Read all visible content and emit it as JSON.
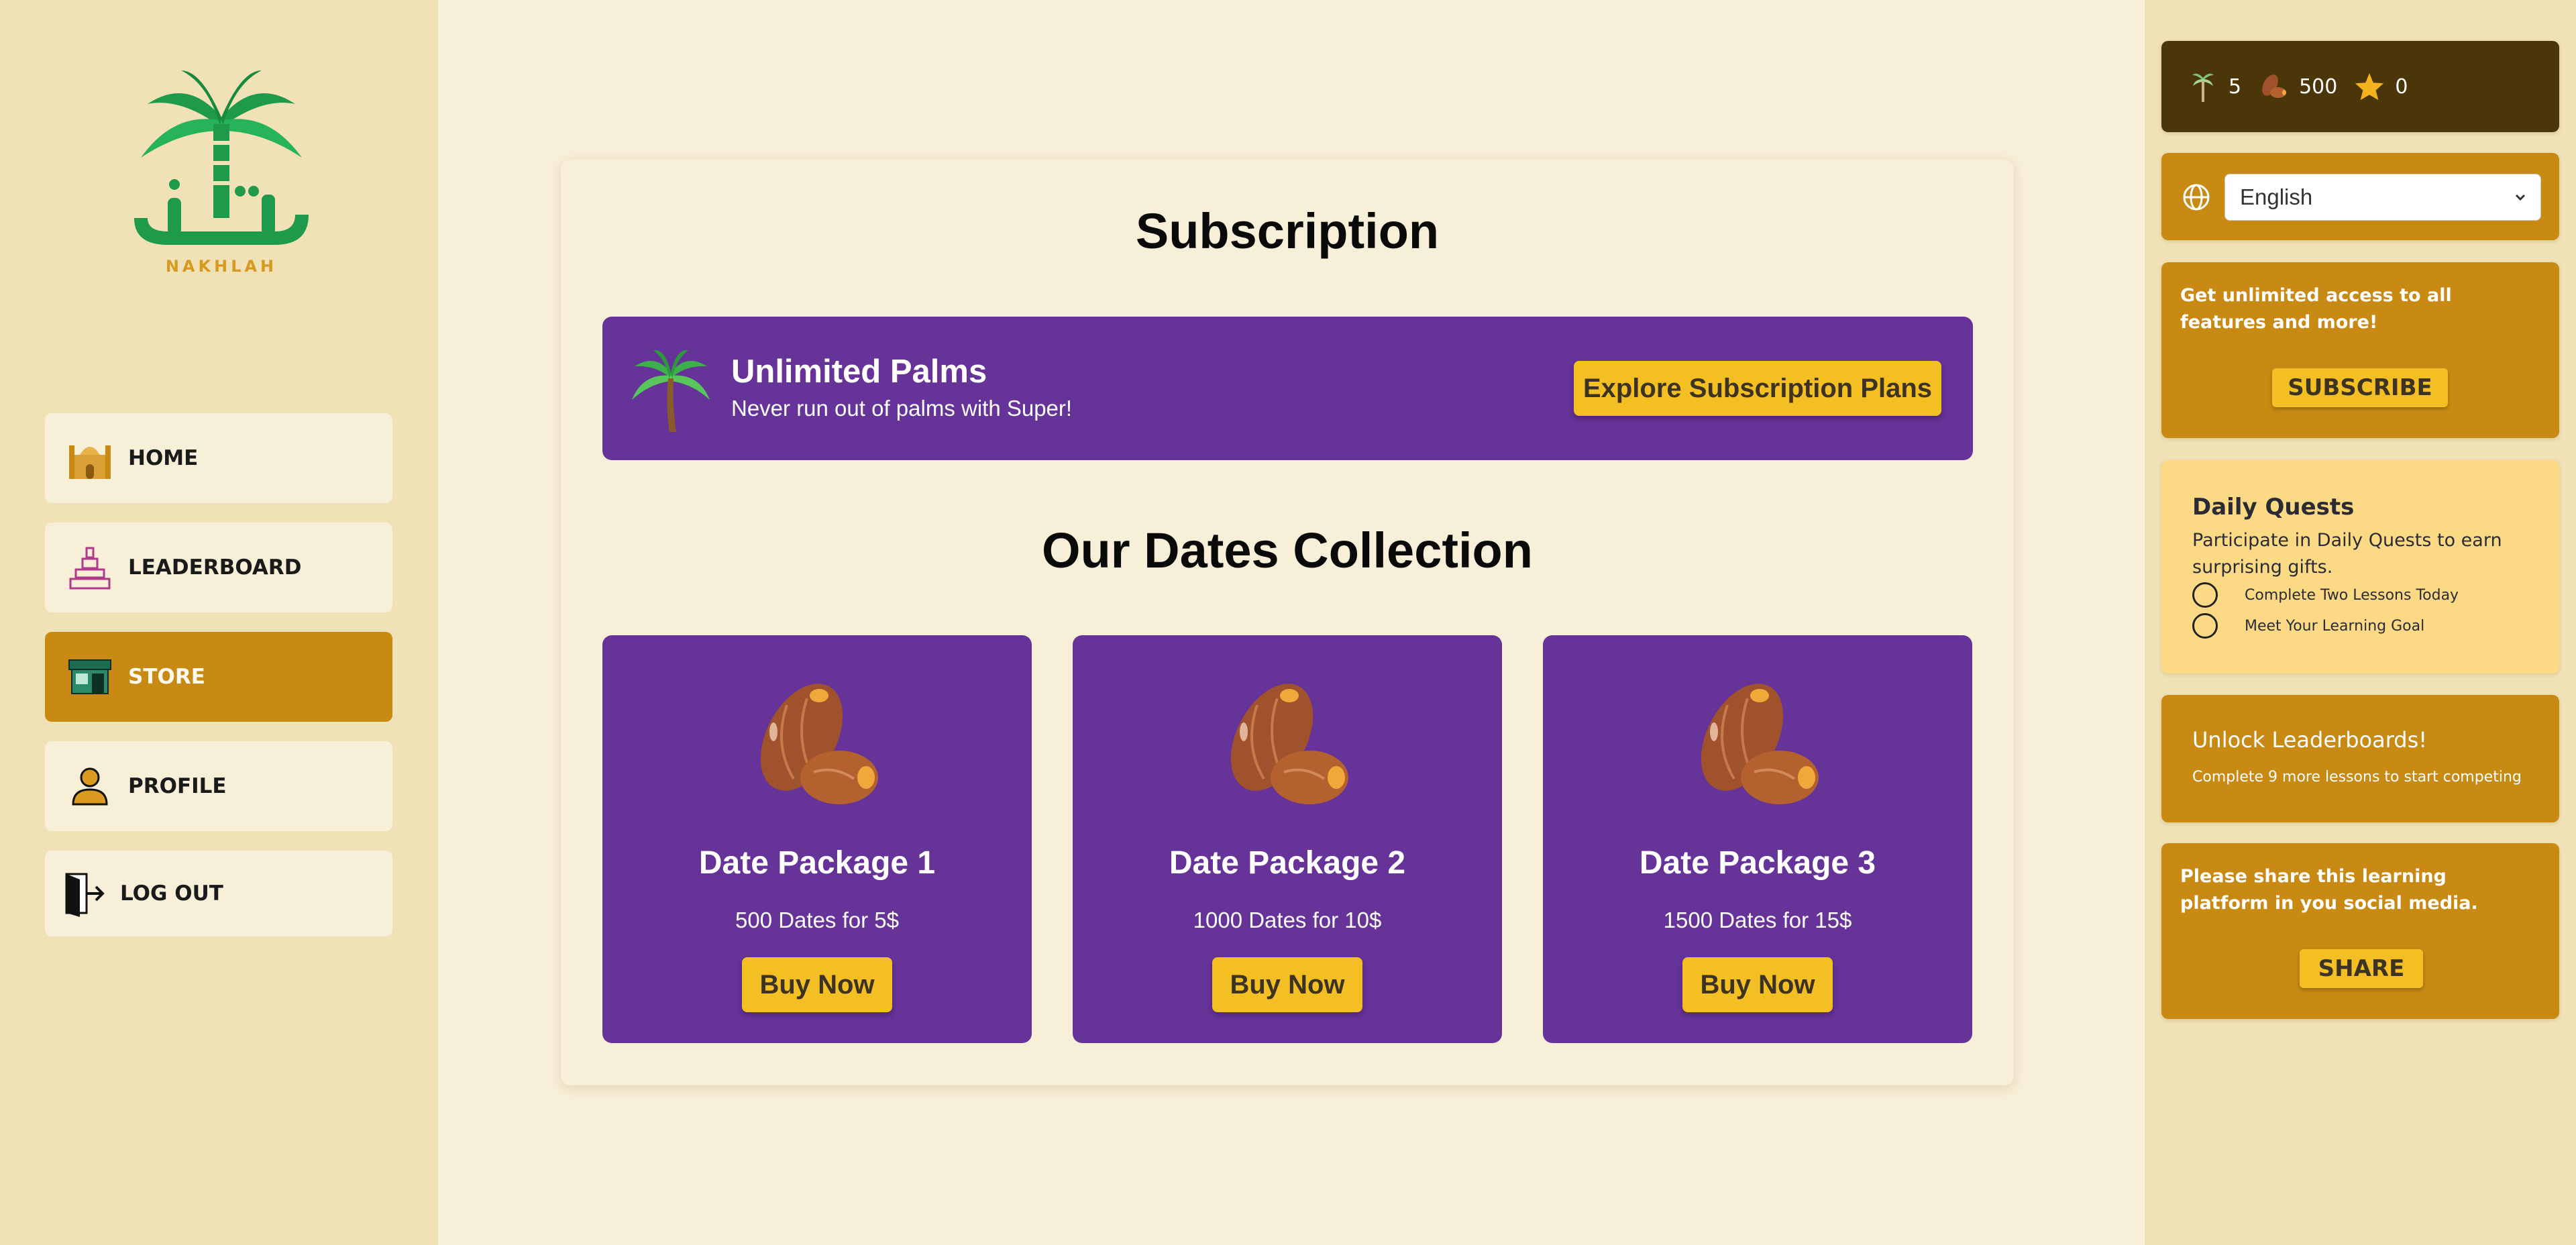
{
  "brand": {
    "logo_text": "NAKHLAH"
  },
  "nav": {
    "items": [
      {
        "label": "HOME",
        "icon": "mosque-icon"
      },
      {
        "label": "LEADERBOARD",
        "icon": "tower-icon"
      },
      {
        "label": "STORE",
        "icon": "shop-icon",
        "active": true
      },
      {
        "label": "PROFILE",
        "icon": "user-icon"
      },
      {
        "label": "LOG OUT",
        "icon": "logout-icon"
      }
    ]
  },
  "main": {
    "subscription_title": "Subscription",
    "banner": {
      "title": "Unlimited Palms",
      "subtitle": "Never run out of palms with Super!",
      "button": "Explore Subscription Plans"
    },
    "collection_title": "Our Dates Collection",
    "packages": [
      {
        "name": "Date Package 1",
        "desc": "500 Dates for 5$",
        "button": "Buy Now"
      },
      {
        "name": "Date Package 2",
        "desc": "1000 Dates for 10$",
        "button": "Buy Now"
      },
      {
        "name": "Date Package 3",
        "desc": "1500 Dates for 15$",
        "button": "Buy Now"
      }
    ]
  },
  "stats": {
    "palms": "5",
    "dates": "500",
    "stars": "0"
  },
  "language": {
    "selected": "English"
  },
  "promo": {
    "text": "Get unlimited access to all features and more!",
    "button": "SUBSCRIBE"
  },
  "quests": {
    "title": "Daily Quests",
    "desc": "Participate in Daily Quests to earn surprising gifts.",
    "items": [
      "Complete Two Lessons Today",
      "Meet Your Learning Goal"
    ]
  },
  "unlock": {
    "title": "Unlock Leaderboards!",
    "desc": "Complete 9 more lessons to start competing"
  },
  "share": {
    "text": "Please share this learning platform in you social media.",
    "button": "SHARE"
  },
  "colors": {
    "accent": "#c98a14",
    "purple": "#663399",
    "yellow_button": "#f4bf22",
    "background": "#f8efd8",
    "sidebar": "#f0e2b6"
  }
}
